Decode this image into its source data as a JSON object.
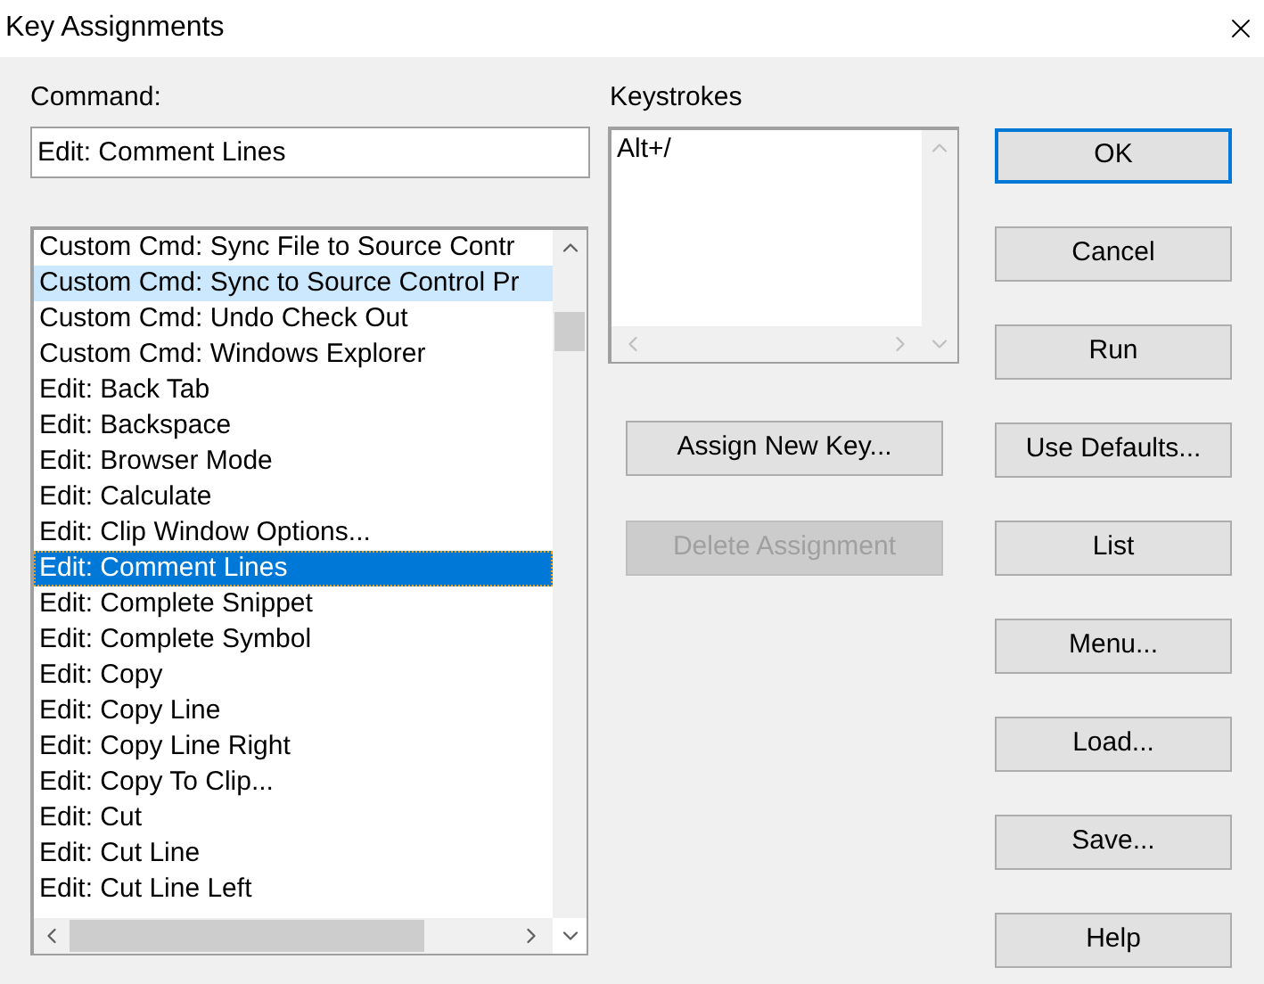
{
  "window": {
    "title": "Key Assignments"
  },
  "command": {
    "label": "Command:",
    "value": "Edit: Comment Lines"
  },
  "commands": [
    {
      "label": "Custom Cmd: Sync File to Source Contr",
      "selected": false
    },
    {
      "label": "Custom Cmd: Sync to Source Control Pr",
      "selected": false,
      "hovered": true
    },
    {
      "label": "Custom Cmd: Undo Check Out",
      "selected": false
    },
    {
      "label": "Custom Cmd: Windows Explorer",
      "selected": false
    },
    {
      "label": "Edit: Back Tab",
      "selected": false
    },
    {
      "label": "Edit: Backspace",
      "selected": false
    },
    {
      "label": "Edit: Browser Mode",
      "selected": false
    },
    {
      "label": "Edit: Calculate",
      "selected": false
    },
    {
      "label": "Edit: Clip Window Options...",
      "selected": false
    },
    {
      "label": "Edit: Comment Lines",
      "selected": true
    },
    {
      "label": "Edit: Complete Snippet",
      "selected": false
    },
    {
      "label": "Edit: Complete Symbol",
      "selected": false
    },
    {
      "label": "Edit: Copy",
      "selected": false
    },
    {
      "label": "Edit: Copy Line",
      "selected": false
    },
    {
      "label": "Edit: Copy Line Right",
      "selected": false
    },
    {
      "label": "Edit: Copy To Clip...",
      "selected": false
    },
    {
      "label": "Edit: Cut",
      "selected": false
    },
    {
      "label": "Edit: Cut Line",
      "selected": false
    },
    {
      "label": "Edit: Cut Line Left",
      "selected": false
    }
  ],
  "keystrokes": {
    "label": "Keystrokes",
    "items": [
      "Alt+/"
    ]
  },
  "middle_buttons": [
    {
      "label": "Assign New Key...",
      "disabled": false
    },
    {
      "label": "Delete Assignment",
      "disabled": true
    }
  ],
  "buttons": [
    {
      "label": "OK",
      "default": true
    },
    {
      "label": "Cancel",
      "default": false
    },
    {
      "label": "Run",
      "default": false
    },
    {
      "label": "Use Defaults...",
      "default": false
    },
    {
      "label": "List",
      "default": false
    },
    {
      "label": "Menu...",
      "default": false
    },
    {
      "label": "Load...",
      "default": false
    },
    {
      "label": "Save...",
      "default": false
    },
    {
      "label": "Help",
      "default": false
    }
  ]
}
